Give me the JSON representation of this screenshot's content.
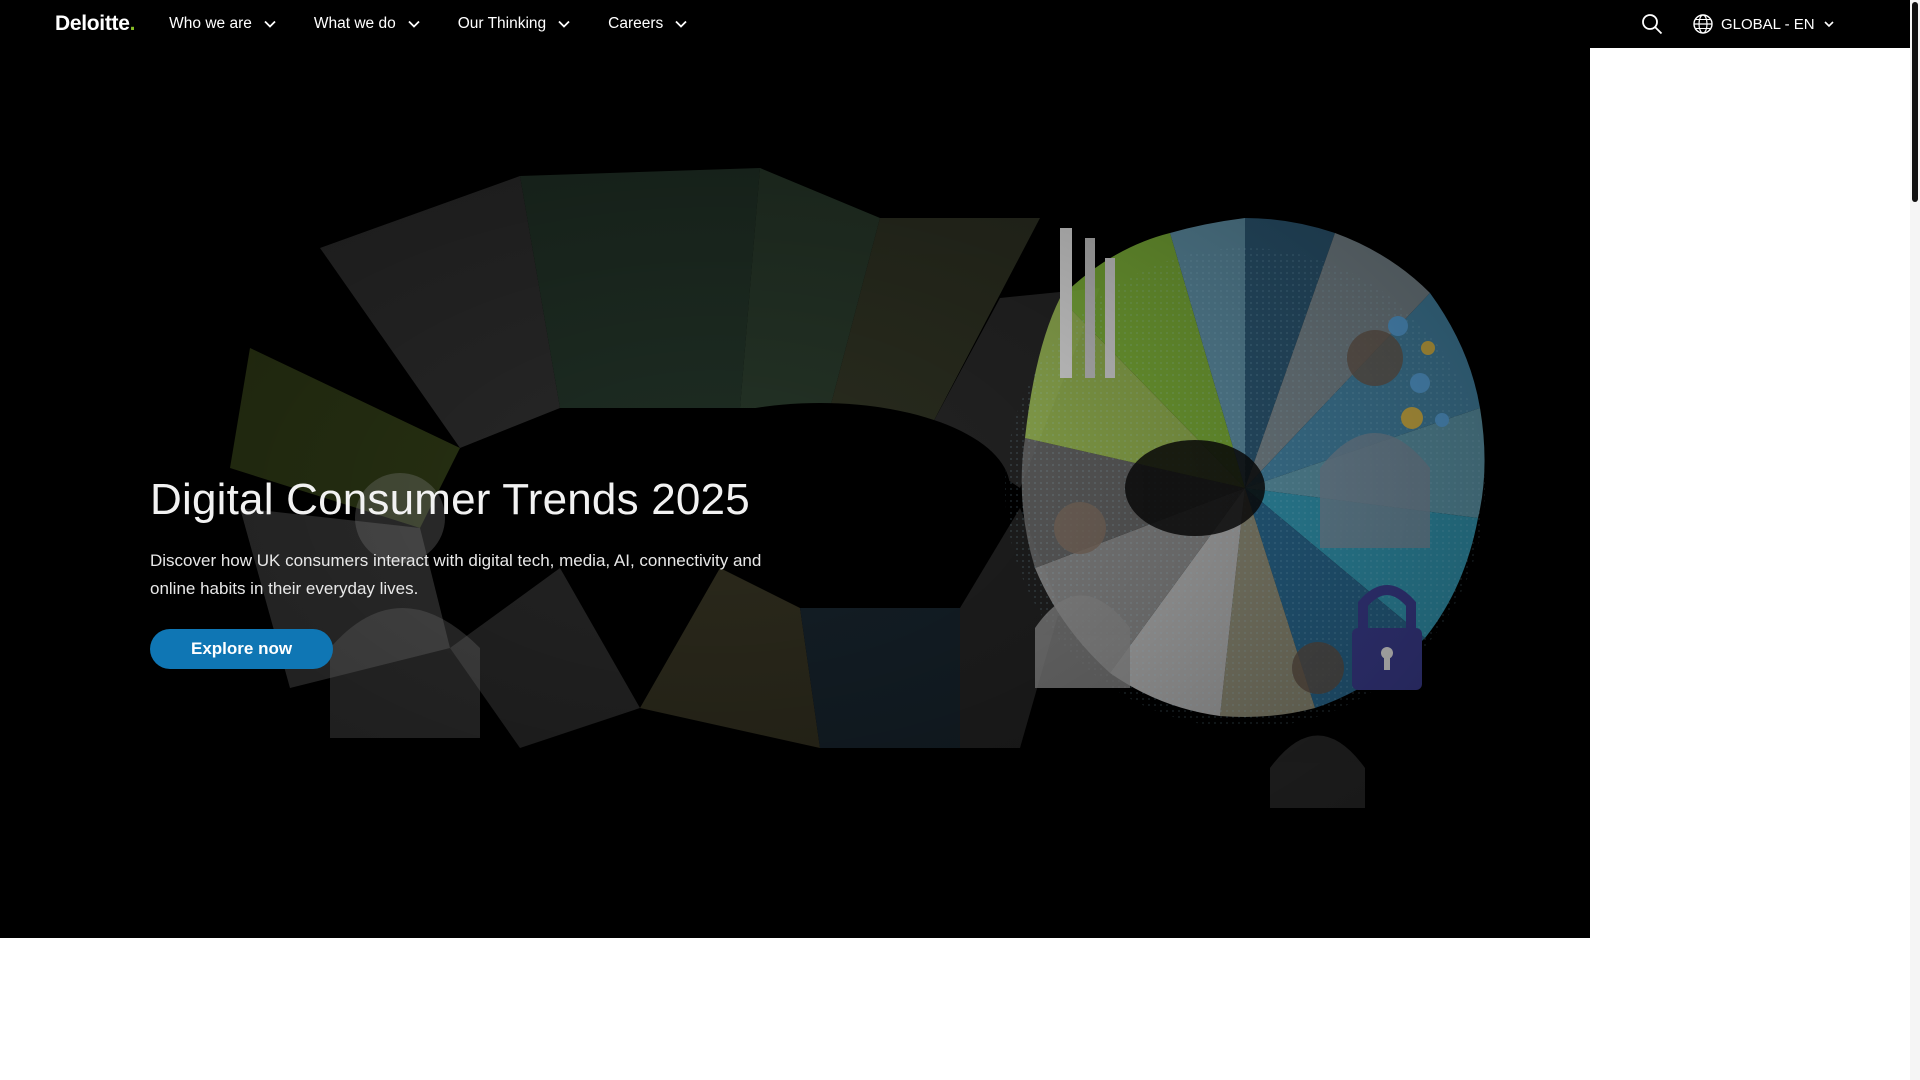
{
  "brand": {
    "name": "Deloitte",
    "dot": "."
  },
  "nav": {
    "items": [
      {
        "label": "Who we are"
      },
      {
        "label": "What we do"
      },
      {
        "label": "Our Thinking"
      },
      {
        "label": "Careers"
      }
    ]
  },
  "tools": {
    "search_icon": "search-icon",
    "locale_label": "GLOBAL - EN",
    "locale_icon": "globe-icon"
  },
  "hero": {
    "title": "Digital Consumer Trends 2025",
    "description": "Discover how UK consumers interact with digital tech, media, AI, connectivity and online habits in their everyday lives.",
    "cta_label": "Explore now"
  },
  "colors": {
    "accent": "#86bc25",
    "cta": "#0f76b4",
    "background": "#000000"
  }
}
